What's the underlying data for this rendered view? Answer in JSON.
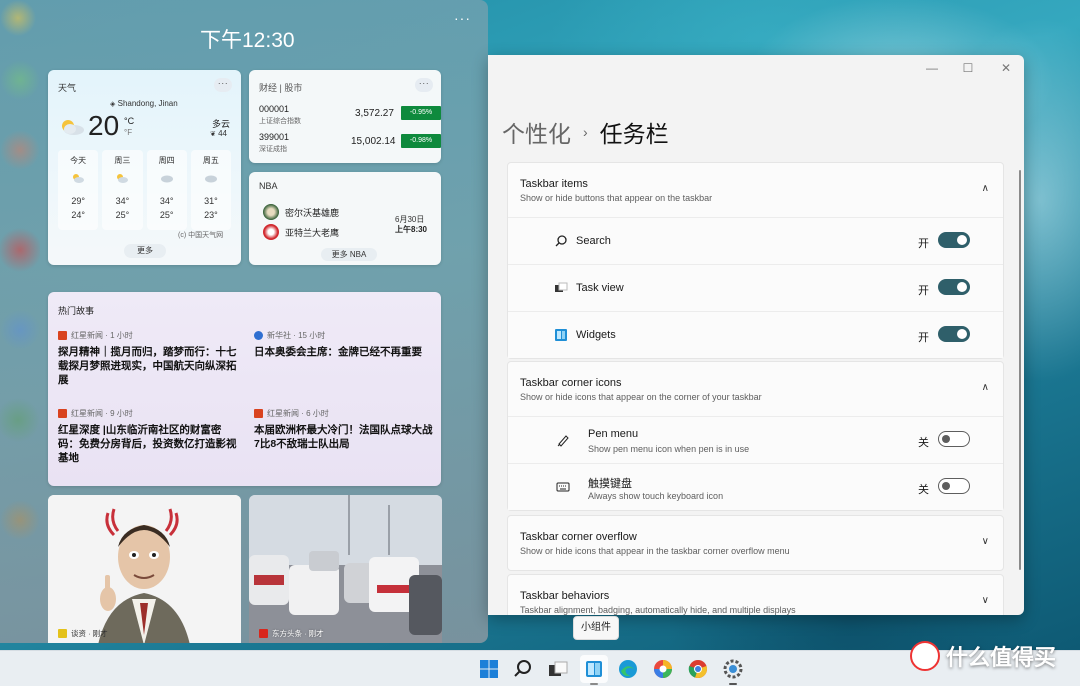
{
  "widgets": {
    "time": "下午12:30",
    "more_dots": "···",
    "weather": {
      "title": "天气",
      "location": "Shandong, Jinan",
      "temp": "20",
      "unit_c": "°C",
      "unit_f": "°F",
      "condition": "多云",
      "aqi": "44",
      "days": [
        {
          "name": "今天",
          "hi": "29°",
          "lo": "24°"
        },
        {
          "name": "周三",
          "hi": "34°",
          "lo": "25°"
        },
        {
          "name": "周四",
          "hi": "34°",
          "lo": "25°"
        },
        {
          "name": "周五",
          "hi": "31°",
          "lo": "23°"
        }
      ],
      "source": "(c) 中国天气网",
      "more": "更多"
    },
    "finance": {
      "title": "财经 | 股市",
      "stocks": [
        {
          "code": "000001",
          "name": "上证综合指数",
          "price": "3,572.27",
          "change": "-0.95%"
        },
        {
          "code": "399001",
          "name": "深证成指",
          "price": "15,002.14",
          "change": "-0.98%"
        }
      ]
    },
    "nba": {
      "title": "NBA",
      "team1": "密尔沃基雄鹿",
      "team2": "亚特兰大老鹰",
      "date": "6月30日",
      "time": "上午8:30",
      "more": "更多 NBA"
    },
    "news": {
      "title": "热门故事",
      "stories": [
        {
          "source": "红星新闻 · 1 小时",
          "headline": "探月精神｜揽月而归，踏梦而行：十七载探月梦照进现实，中国航天向纵深拓展"
        },
        {
          "source": "新华社 · 15 小时",
          "headline": "日本奥委会主席：金牌已经不再重要"
        },
        {
          "source": "红星新闻 · 9 小时",
          "headline": "红星深度 |山东临沂南社区的财富密码：免费分房背后，投资数亿打造影视基地"
        },
        {
          "source": "红星新闻 · 6 小时",
          "headline": "本届欧洲杯最大冷门！法国队点球大战7比8不敌瑞士队出局"
        }
      ]
    },
    "images": [
      {
        "caption": "谈资 · 刚才"
      },
      {
        "caption": "东方头条 · 刚才"
      }
    ]
  },
  "settings": {
    "controls": {
      "minimize": "—",
      "maximize": "☐",
      "close": "✕"
    },
    "breadcrumb_parent": "个性化",
    "breadcrumb_sep": "›",
    "breadcrumb_current": "任务栏",
    "sections": {
      "items": {
        "title": "Taskbar items",
        "subtitle": "Show or hide buttons that appear on the taskbar",
        "chevron": "∧",
        "rows": [
          {
            "label": "Search",
            "state": "开"
          },
          {
            "label": "Task view",
            "state": "开"
          },
          {
            "label": "Widgets",
            "state": "开"
          }
        ]
      },
      "corner": {
        "title": "Taskbar corner icons",
        "subtitle": "Show or hide icons that appear on the corner of your taskbar",
        "chevron": "∧",
        "rows": [
          {
            "label": "Pen menu",
            "sub": "Show pen menu icon when pen is in use",
            "state": "关"
          },
          {
            "label": "触摸键盘",
            "sub": "Always show touch keyboard icon",
            "state": "关"
          }
        ]
      },
      "overflow": {
        "title": "Taskbar corner overflow",
        "subtitle": "Show or hide icons that appear in the taskbar corner overflow menu",
        "chevron": "∨"
      },
      "behaviors": {
        "title": "Taskbar behaviors",
        "subtitle": "Taskbar alignment, badging, automatically hide, and multiple displays",
        "chevron": "∨"
      }
    }
  },
  "tooltip": "小组件",
  "brand": "什么值得买",
  "colors": {
    "toggle_on": "#2f5f6a",
    "stock_down": "#0e8a3d",
    "accent": "#0067c0"
  }
}
